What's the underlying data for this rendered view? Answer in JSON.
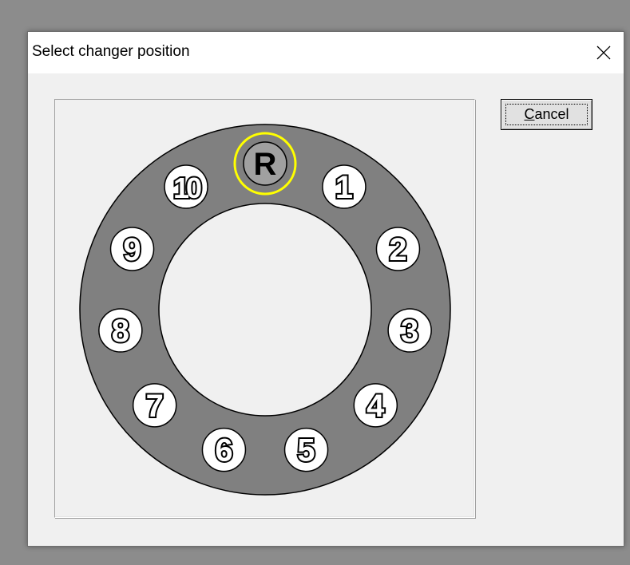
{
  "window": {
    "title": "Select changer position",
    "close_icon": "close-icon"
  },
  "buttons": {
    "cancel_mnemonic": "C",
    "cancel_rest": "ancel"
  },
  "changer": {
    "ring_color": "#808080",
    "selected_color": "#ffff00",
    "slot_fill": "#ffffff",
    "selected_fill": "#a0a0a0",
    "positions": [
      {
        "label": "R",
        "selected": true
      },
      {
        "label": "1",
        "selected": false
      },
      {
        "label": "2",
        "selected": false
      },
      {
        "label": "3",
        "selected": false
      },
      {
        "label": "4",
        "selected": false
      },
      {
        "label": "5",
        "selected": false
      },
      {
        "label": "6",
        "selected": false
      },
      {
        "label": "7",
        "selected": false
      },
      {
        "label": "8",
        "selected": false
      },
      {
        "label": "9",
        "selected": false
      },
      {
        "label": "10",
        "selected": false
      }
    ]
  }
}
